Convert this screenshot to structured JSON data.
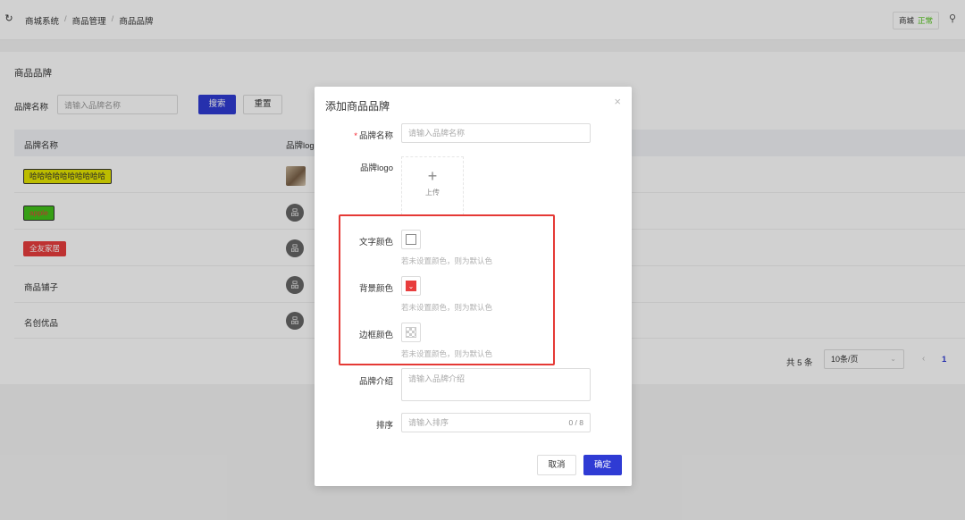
{
  "header": {
    "breadcrumbs": [
      "商城系统",
      "商品管理",
      "商品品牌"
    ],
    "store_label": "商城",
    "store_status": "正常"
  },
  "page": {
    "title": "商品品牌",
    "search_label": "品牌名称",
    "search_placeholder": "请输入品牌名称",
    "search_button": "搜索",
    "reset_button": "重置"
  },
  "table": {
    "columns": [
      "品牌名称",
      "品牌logo"
    ],
    "rows": [
      {
        "name": "哈哈哈哈哈哈哈哈哈哈",
        "logo": "photo",
        "text_color": "#333333",
        "bg_color": "#e6e600",
        "border_color": "#333333"
      },
      {
        "name": "apple",
        "logo": "default",
        "text_color": "#e83d3d",
        "bg_color": "#43c21a",
        "border_color": "#333333"
      },
      {
        "name": "全友家居",
        "logo": "default",
        "text_color": "#ffffff",
        "bg_color": "#e83d3d",
        "border_color": "#e83d3d"
      },
      {
        "name": "商品铺子",
        "logo": "default"
      },
      {
        "name": "名创优品",
        "logo": "default"
      }
    ],
    "logo_default_glyph": "品"
  },
  "pagination": {
    "total": "共 5 条",
    "page_size": "10条/页",
    "current_page": "1"
  },
  "modal": {
    "title": "添加商品品牌",
    "required_mark": "*",
    "fields": {
      "name_label": "品牌名称",
      "name_placeholder": "请输入品牌名称",
      "logo_label": "品牌logo",
      "upload_text": "上传",
      "text_color_label": "文字颜色",
      "bg_color_label": "背景颜色",
      "border_color_label": "边框颜色",
      "color_hint": "若未设置颜色，则为默认色",
      "intro_label": "品牌介绍",
      "intro_placeholder": "请输入品牌介绍",
      "sort_label": "排序",
      "sort_placeholder": "请输入排序",
      "sort_counter": "0 / 8"
    },
    "cancel_button": "取消",
    "confirm_button": "确定",
    "bg_color_value": "#e83d3d"
  }
}
